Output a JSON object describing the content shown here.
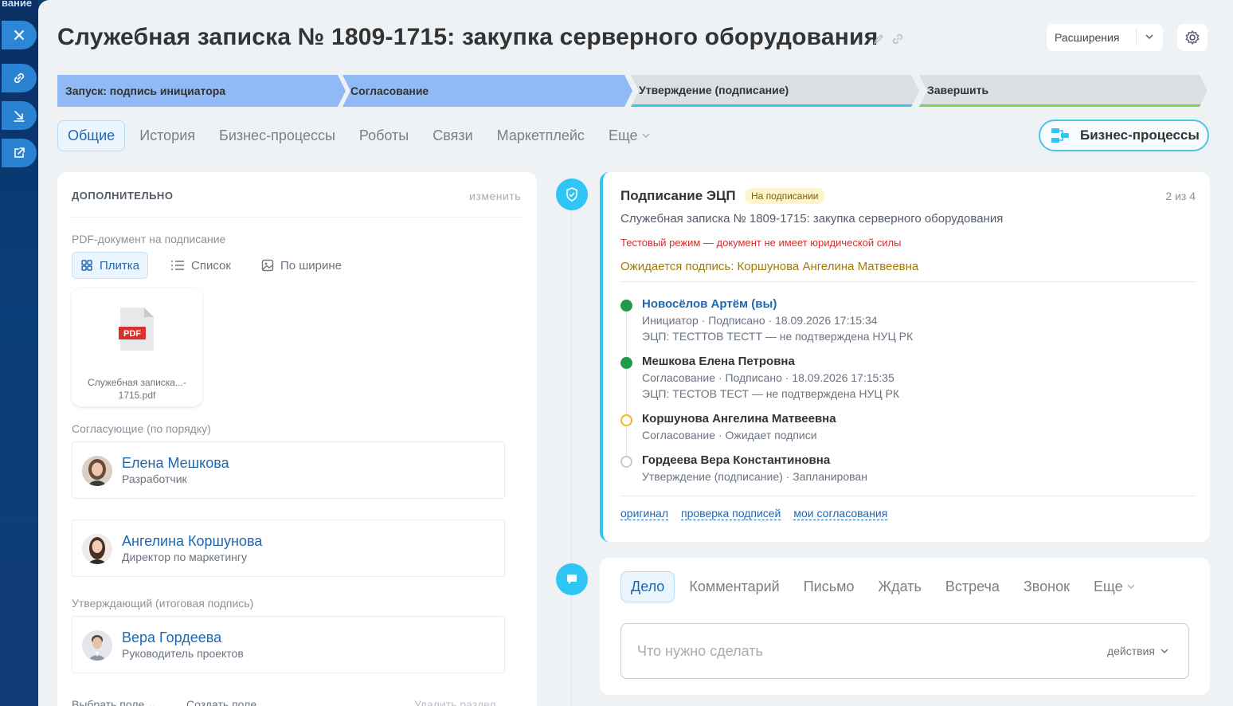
{
  "rail": {
    "top_text": "вание"
  },
  "header": {
    "title": "Служебная записка № 1809-1715: закупка серверного оборудования",
    "extensions_label": "Расширения"
  },
  "stages": [
    {
      "label": "Запуск: подпись инициатора"
    },
    {
      "label": "Согласование"
    },
    {
      "label": "Утверждение (подписание)"
    },
    {
      "label": "Завершить"
    }
  ],
  "tabs": [
    {
      "label": "Общие"
    },
    {
      "label": "История"
    },
    {
      "label": "Бизнес-процессы"
    },
    {
      "label": "Роботы"
    },
    {
      "label": "Связи"
    },
    {
      "label": "Маркетплейс"
    },
    {
      "label": "Еще"
    }
  ],
  "bp_button": "Бизнес-процессы",
  "left_panel": {
    "heading": "ДОПОЛНИТЕЛЬНО",
    "edit": "изменить",
    "pdf_label": "PDF-документ на подписание",
    "view_modes": [
      "Плитка",
      "Список",
      "По ширине"
    ],
    "file": {
      "line1": "Служебная записка...-",
      "line2": "1715.pdf",
      "badge": "PDF"
    },
    "approvers_label": "Согласующие (по порядку)",
    "approvers": [
      {
        "name": "Елена Мешкова",
        "role": "Разработчик"
      },
      {
        "name": "Ангелина Коршунова",
        "role": "Директор по маркетингу"
      }
    ],
    "final_label": "Утверждающий (итоговая подпись)",
    "final": {
      "name": "Вера Гордеева",
      "role": "Руководитель проектов"
    },
    "bottom": {
      "select_field": "Выбрать поле",
      "create_field": "Создать поле",
      "delete_section": "Удалить раздел"
    }
  },
  "signing": {
    "title": "Подписание ЭЦП",
    "badge": "На подписании",
    "count": "2 из 4",
    "document": "Служебная записка № 1809-1715: закупка серверного оборудования",
    "warning": "Тестовый режим — документ не имеет юридической силы",
    "waiting": "Ожидается подпись: Коршунова Ангелина Матвеевна",
    "signers": [
      {
        "name": "Новосёлов Артём (вы)",
        "line1": "Инициатор · Подписано · 18.09.2026 17:15:34",
        "line2": "ЭЦП: ТЕСТТОВ ТЕСТТ — не подтверждена НУЦ РК",
        "status": "done"
      },
      {
        "name": "Мешкова Елена Петровна",
        "line1": "Согласование · Подписано · 18.09.2026 17:15:35",
        "line2": "ЭЦП: ТЕСТОВ ТЕСТ — не подтверждена НУЦ РК",
        "status": "done"
      },
      {
        "name": "Коршунова Ангелина Матвеевна",
        "line1": "Согласование · Ожидает подписи",
        "status": "wait"
      },
      {
        "name": "Гордеева Вера Константиновна",
        "line1": "Утверждение (подписание) · Запланирован",
        "status": "plan"
      }
    ],
    "links": [
      "оригинал",
      "проверка подписей",
      "мои согласования"
    ]
  },
  "activity": {
    "tabs": [
      "Дело",
      "Комментарий",
      "Письмо",
      "Ждать",
      "Встреча",
      "Звонок",
      "Еще"
    ],
    "placeholder": "Что нужно сделать",
    "actions": "действия"
  },
  "colors": {
    "accent": "#2fc6f6",
    "link": "#2067b0",
    "stage_done": "#8fbaf5",
    "stage_pending": "#dcdfe2",
    "signed": "#1f9a4a",
    "waiting": "#f2b814",
    "warning": "#d12d2d"
  },
  "icons": [
    "close-icon",
    "link-icon",
    "download-icon",
    "open-external-icon",
    "edit-icon",
    "copy-link-icon",
    "chevron-down-icon",
    "gear-icon",
    "business-process-icon",
    "tile-icon",
    "list-icon",
    "image-icon",
    "pdf-file-icon",
    "shield-icon",
    "comment-icon"
  ]
}
